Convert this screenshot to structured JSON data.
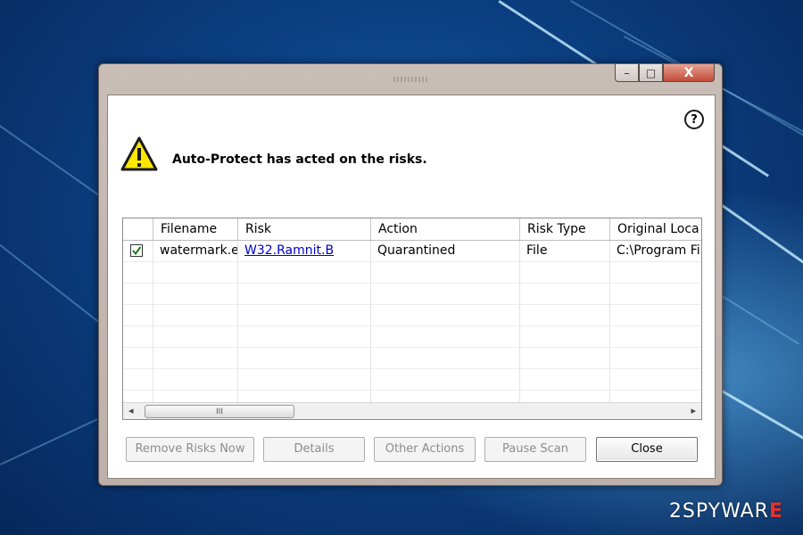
{
  "window": {
    "controls": {
      "minimize": "–",
      "maximize": "□",
      "close": "X"
    },
    "help_label": "?"
  },
  "alert": {
    "icon": "warning-triangle-icon",
    "message": "Auto-Protect has acted on the risks."
  },
  "table": {
    "columns": [
      "",
      "Filename",
      "Risk",
      "Action",
      "Risk Type",
      "Original Loca"
    ],
    "rows": [
      {
        "checked": true,
        "filename": "watermark.e",
        "risk": "W32.Ramnit.B",
        "action": "Quarantined",
        "risk_type": "File",
        "original_location": "C:\\Program Fi"
      }
    ],
    "scroll_left": "◂",
    "scroll_right": "▸",
    "thumb_grip": "III"
  },
  "buttons": {
    "remove": "Remove Risks Now",
    "details": "Details",
    "other": "Other Actions",
    "pause": "Pause Scan",
    "close": "Close"
  },
  "watermark": {
    "number": "2",
    "spy": "SPY",
    "war": "WAR",
    "e": "E"
  },
  "colors": {
    "link": "#0000cc",
    "warning_yellow": "#ffe600",
    "close_button": "#c24c3a"
  }
}
